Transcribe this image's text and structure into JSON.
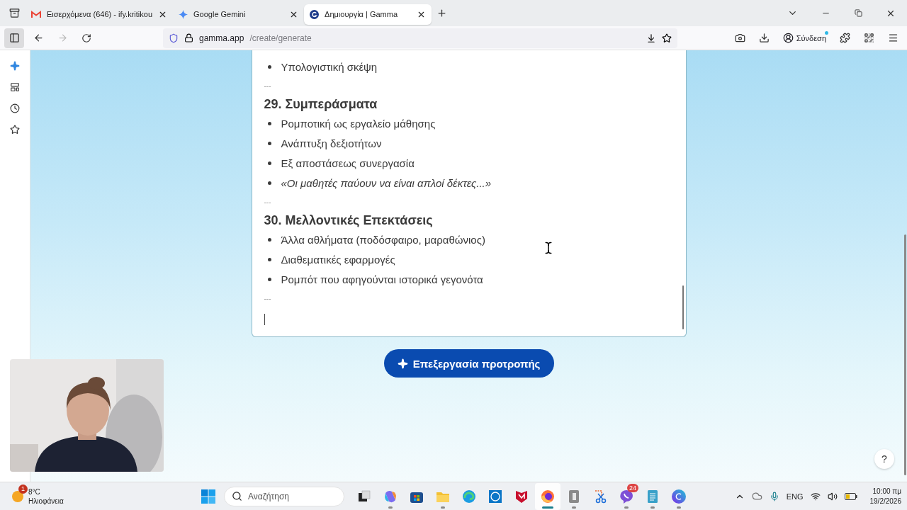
{
  "browser": {
    "tabs": [
      {
        "kind": "mail",
        "title": "Εισερχόμενα (646) - ify.kritikou",
        "selected": false
      },
      {
        "kind": "gemini",
        "title": "Google Gemini",
        "selected": false
      },
      {
        "kind": "gamma",
        "title": "Δημιουργία | Gamma",
        "selected": true
      }
    ],
    "url": {
      "host": "gamma.app",
      "path": "/create/generate"
    },
    "sign_in": "Σύνδεση"
  },
  "document": {
    "blocks": [
      {
        "kind": "bullet",
        "text": "Υπολογιστική σκέψη"
      },
      {
        "kind": "separator",
        "text": "---"
      },
      {
        "kind": "heading",
        "text": "29. Συμπεράσματα"
      },
      {
        "kind": "bullet",
        "text": "Ρομποτική ως εργαλείο μάθησης"
      },
      {
        "kind": "bullet",
        "text": "Ανάπτυξη δεξιοτήτων"
      },
      {
        "kind": "bullet",
        "text": "Εξ αποστάσεως συνεργασία"
      },
      {
        "kind": "bullet",
        "text": "«Οι μαθητές παύουν να είναι απλοί δέκτες...»",
        "italic": true
      },
      {
        "kind": "separator",
        "text": "---"
      },
      {
        "kind": "heading",
        "text": "30. Μελλοντικές Επεκτάσεις"
      },
      {
        "kind": "bullet",
        "text": "Άλλα αθλήματα (ποδόσφαιρο, μαραθώνιος)"
      },
      {
        "kind": "bullet",
        "text": "Διαθεματικές εφαρμογές"
      },
      {
        "kind": "bullet",
        "text": "Ρομπότ που αφηγούνται ιστορικά γεγονότα"
      },
      {
        "kind": "separator",
        "text": "---"
      }
    ]
  },
  "edit_button": "Επεξεργασία προτροπής",
  "help_button": "?",
  "taskbar": {
    "weather": {
      "badge": "1",
      "temperature": "8°C",
      "condition": "Ηλιοφάνεια"
    },
    "search": {
      "placeholder": "Αναζήτηση"
    },
    "apps": [
      {
        "kind": "task-view",
        "running": false,
        "selected": false
      },
      {
        "kind": "copilot",
        "running": true,
        "selected": false
      },
      {
        "kind": "store",
        "running": false,
        "selected": false
      },
      {
        "kind": "folder",
        "running": true,
        "selected": false
      },
      {
        "kind": "edge",
        "running": false,
        "selected": false
      },
      {
        "kind": "dell",
        "running": false,
        "selected": false
      },
      {
        "kind": "mcafee",
        "running": false,
        "selected": false
      },
      {
        "kind": "firefox",
        "running": true,
        "selected": true
      },
      {
        "kind": "grey-app",
        "running": true,
        "selected": false
      },
      {
        "kind": "snip",
        "running": false,
        "selected": false
      },
      {
        "kind": "viber",
        "running": true,
        "selected": false,
        "badge": "24"
      },
      {
        "kind": "notepad",
        "running": true,
        "selected": false
      },
      {
        "kind": "canva",
        "running": true,
        "selected": false
      }
    ],
    "language": "ENG",
    "time": "10:00 πμ",
    "date": "19/2/2026"
  }
}
